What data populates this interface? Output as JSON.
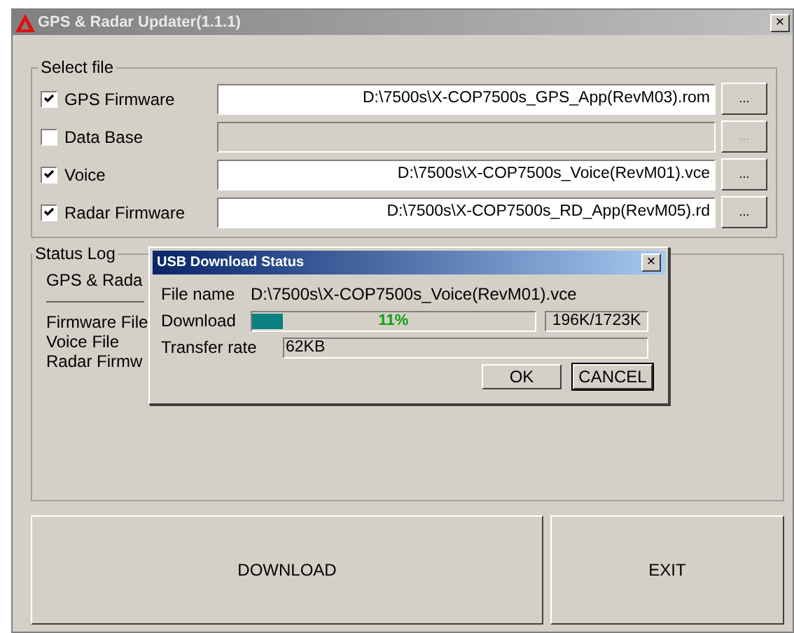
{
  "window": {
    "title": "GPS & Radar Updater(1.1.1)",
    "close": "×"
  },
  "select_file": {
    "title": "Select file",
    "rows": [
      {
        "label": "GPS Firmware",
        "checked": true,
        "path": "D:\\7500s\\X-COP7500s_GPS_App(RevM03).rom",
        "browse": "...",
        "disabled": false
      },
      {
        "label": "Data Base",
        "checked": false,
        "path": "",
        "browse": "...",
        "disabled": true
      },
      {
        "label": "Voice",
        "checked": true,
        "path": "D:\\7500s\\X-COP7500s_Voice(RevM01).vce",
        "browse": "...",
        "disabled": false
      },
      {
        "label": "Radar Firmware",
        "checked": true,
        "path": "D:\\7500s\\X-COP7500s_RD_App(RevM05).rd",
        "browse": "...",
        "disabled": false
      }
    ]
  },
  "status_log": {
    "title": "Status Log",
    "heading": "GPS & Rada",
    "lines": [
      "Firmware File",
      "Voice File",
      "Radar Firmw"
    ]
  },
  "dialog": {
    "title": "USB Download Status",
    "close": "×",
    "file_label": "File name",
    "file_value": "D:\\7500s\\X-COP7500s_Voice(RevM01).vce",
    "download_label": "Download",
    "level": 0.11,
    "percent": "11%",
    "size": "196K/1723K",
    "rate_label": "Transfer rate",
    "rate_value": "62KB",
    "buttons": [
      {
        "label": "OK",
        "default": false
      },
      {
        "label": "CANCEL",
        "default": true
      }
    ]
  },
  "buttons": [
    "DOWNLOAD",
    "EXIT"
  ]
}
